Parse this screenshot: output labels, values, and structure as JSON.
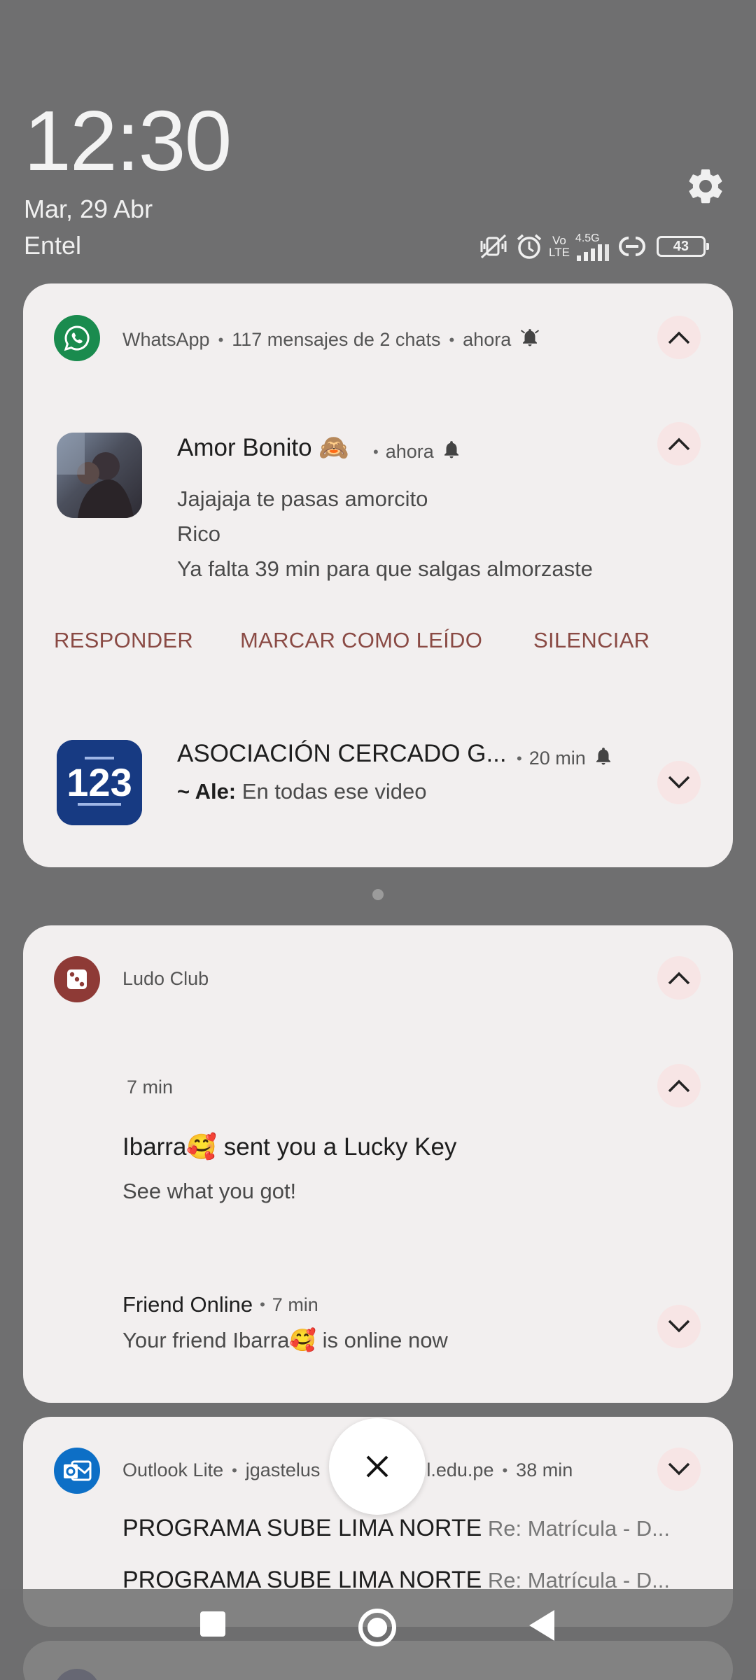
{
  "header": {
    "time": "12:30",
    "date": "Mar, 29 Abr",
    "carrier": "Entel",
    "network_label_top": "Vo",
    "network_label_bottom": "LTE",
    "network_gen": "4.5G",
    "battery": "43"
  },
  "whatsapp": {
    "app_name": "WhatsApp",
    "summary": "117 mensajes de 2 chats",
    "time": "ahora",
    "chat1": {
      "name": "Amor Bonito 🙈",
      "time": "ahora",
      "messages": [
        "Jajajaja te pasas amorcito",
        "Rico",
        "Ya falta 39 min para que salgas almorzaste"
      ],
      "actions": {
        "reply": "RESPONDER",
        "mark_read": "MARCAR COMO LEÍDO",
        "mute": "SILENCIAR"
      }
    },
    "chat2": {
      "name": "ASOCIACIÓN CERCADO G...",
      "time": "20 min",
      "sender": "~ Ale:",
      "message": "En todas ese video",
      "avatar_text": "123"
    }
  },
  "ludo": {
    "app_name": "Ludo Club",
    "notif1": {
      "time": "7 min",
      "title": "Ibarra🥰 sent you a Lucky Key",
      "body": "See what you got!"
    },
    "notif2": {
      "title": "Friend Online",
      "time": "7 min",
      "body": "Your friend Ibarra🥰 is online now"
    }
  },
  "outlook": {
    "app_name": "Outlook Lite",
    "account_start": "jgastelus",
    "account_end": "l.edu.pe",
    "time": "38 min",
    "items": [
      {
        "sender": "PROGRAMA SUBE LIMA NORTE",
        "subject": "Re: Matrícula - D..."
      },
      {
        "sender": "PROGRAMA SUBE LIMA NORTE",
        "subject": "Re: Matrícula - D..."
      }
    ]
  },
  "colors": {
    "background": "#6f6f70",
    "card": "#f2efef",
    "whatsapp_green": "#1a8b4e",
    "action_text": "#8a4a44",
    "ludo_red": "#8e3a36",
    "outlook_blue": "#0d6fc6"
  }
}
